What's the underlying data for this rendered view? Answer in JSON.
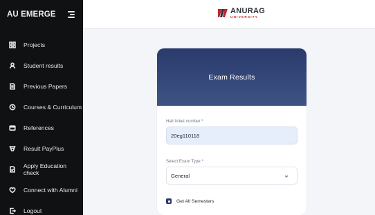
{
  "sidebar": {
    "title": "AU EMERGE",
    "items": [
      {
        "label": "Projects",
        "icon": "grid-icon"
      },
      {
        "label": "Student results",
        "icon": "user-icon"
      },
      {
        "label": "Previous Papers",
        "icon": "document-icon"
      },
      {
        "label": "Courses & Curriculum",
        "icon": "book-icon"
      },
      {
        "label": "References",
        "icon": "folder-icon"
      },
      {
        "label": "Result PayPlus",
        "icon": "payment-icon"
      },
      {
        "label": "Apply Education check",
        "icon": "check-icon"
      },
      {
        "label": "Connect with Alumni",
        "icon": "heart-icon"
      },
      {
        "label": "Logout",
        "icon": "logout-icon"
      }
    ]
  },
  "header": {
    "logo_name": "ANURAG",
    "logo_sub": "UNIVERSITY"
  },
  "card": {
    "title": "Exam Results",
    "hall_ticket_label": "Hall ticket number *",
    "hall_ticket_value": "20eg110118",
    "exam_type_label": "Select Exam Type *",
    "exam_type_value": "General",
    "checkbox_label": "Get All Semesters"
  },
  "colors": {
    "sidebar_bg": "#0f1113",
    "hero_top": "#2a3a6c",
    "hero_bottom": "#3d5483",
    "input_highlight": "#e6eefb",
    "logo_accent": "#c1262c"
  }
}
